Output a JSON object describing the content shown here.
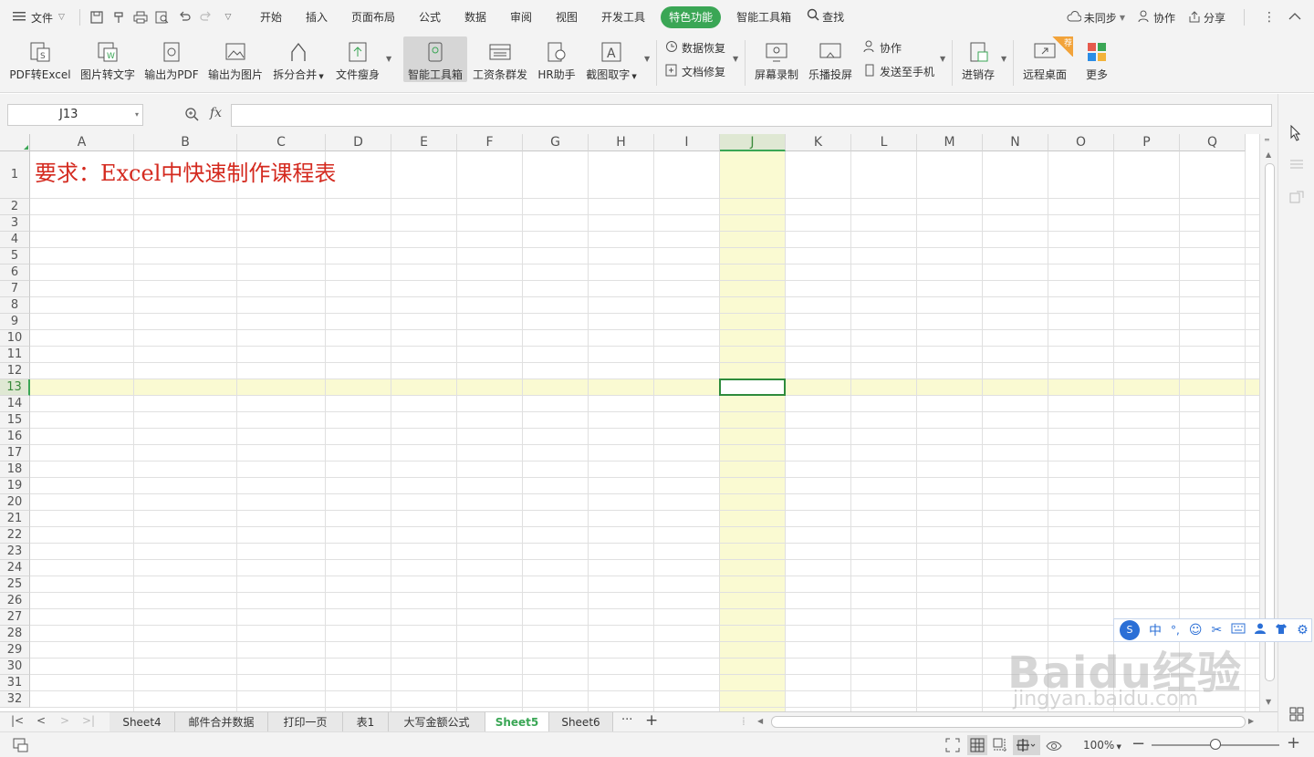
{
  "menubar": {
    "file_label": "文件",
    "tabs": [
      "开始",
      "插入",
      "页面布局",
      "公式",
      "数据",
      "审阅",
      "视图",
      "开发工具",
      "特色功能",
      "智能工具箱"
    ],
    "active_tab": "特色功能",
    "search_label": "查找",
    "sync_label": "未同步",
    "collab_label": "协作",
    "share_label": "分享"
  },
  "ribbon": {
    "buttons": [
      "PDF转Excel",
      "图片转文字",
      "输出为PDF",
      "输出为图片",
      "拆分合并",
      "文件瘦身",
      "智能工具箱",
      "工资条群发",
      "HR助手",
      "截图取字",
      "屏幕录制",
      "乐播投屏",
      "进销存",
      "远程桌面",
      "更多"
    ],
    "small": [
      "数据恢复",
      "文档修复",
      "协作",
      "发送至手机"
    ],
    "badge": "荐",
    "selected": "智能工具箱"
  },
  "formula_bar": {
    "name_box": "J13",
    "fx_label": "fx",
    "formula": ""
  },
  "sheet": {
    "columns": [
      "A",
      "B",
      "C",
      "D",
      "E",
      "F",
      "G",
      "H",
      "I",
      "J",
      "K",
      "L",
      "M",
      "N",
      "O",
      "P",
      "Q"
    ],
    "rows": [
      "1",
      "2",
      "3",
      "4",
      "5",
      "6",
      "7",
      "8",
      "9",
      "10",
      "11",
      "12",
      "13",
      "14",
      "15",
      "16",
      "17",
      "18",
      "19",
      "20",
      "21",
      "22",
      "23",
      "24",
      "25",
      "26",
      "27",
      "28",
      "29",
      "30",
      "31",
      "32"
    ],
    "selected_col": "J",
    "selected_row": "13",
    "cell_A1": "要求：Excel中快速制作课程表",
    "title_color": "#d42a1f"
  },
  "tabs": {
    "sheets": [
      "Sheet4",
      "邮件合并数据",
      "打印一页",
      "表1",
      "大写金额公式",
      "Sheet5",
      "Sheet6"
    ],
    "active": "Sheet5",
    "more": "···",
    "add": "+"
  },
  "status": {
    "zoom": "100%"
  },
  "ime": {
    "lang": "中",
    "punct": "°,"
  },
  "watermark": {
    "brand": "Baidu经验",
    "url": "jingyan.baidu.com"
  },
  "colors": {
    "accent": "#3aa655",
    "highlight": "#fafad2"
  }
}
